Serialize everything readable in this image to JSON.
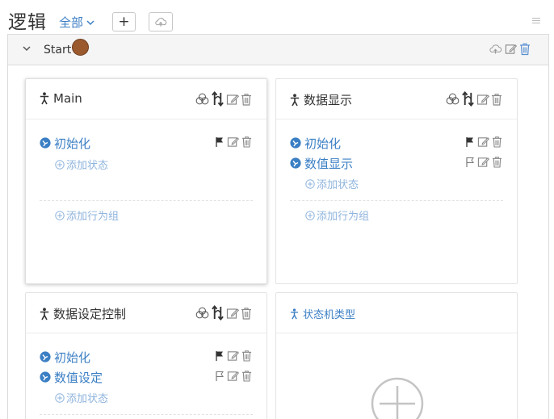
{
  "header": {
    "title": "逻辑",
    "filter_label": "全部",
    "add_button": "+"
  },
  "group": {
    "name": "Start",
    "status_color": "#9a5a2e"
  },
  "cards": [
    {
      "title": "Main",
      "states": [
        {
          "name": "初始化",
          "initial": true
        }
      ],
      "add_state_label": "添加状态",
      "add_group_label": "添加行为组"
    },
    {
      "title": "数据显示",
      "states": [
        {
          "name": "初始化",
          "initial": true
        },
        {
          "name": "数值显示",
          "initial": false
        }
      ],
      "add_state_label": "添加状态",
      "add_group_label": "添加行为组"
    },
    {
      "title": "数据设定控制",
      "states": [
        {
          "name": "初始化",
          "initial": true
        },
        {
          "name": "数值设定",
          "initial": false
        }
      ],
      "add_state_label": "添加状态"
    }
  ],
  "type_card": {
    "title": "状态机类型"
  },
  "colors": {
    "accent": "#3b7fc4",
    "link_light": "#8fb4dd",
    "border": "#dcdcdc"
  }
}
